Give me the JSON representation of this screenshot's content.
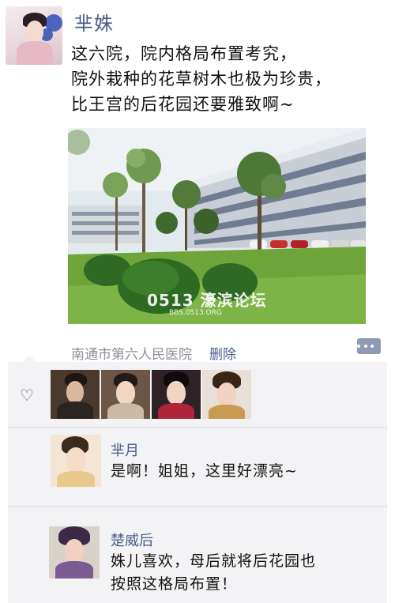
{
  "post": {
    "author": "芈姝",
    "text_lines": [
      "这六院，院内格局布置考究，",
      "院外栽种的花草树木也极为珍贵，",
      "比王宫的后花园还要雅致啊~"
    ],
    "photo_watermark": "0513 濠滨论坛",
    "photo_watermark_sub": "BBS.0513.ORG",
    "location": "南通市第六人民医院",
    "delete_label": "删除",
    "likes_count": 4
  },
  "comments": [
    {
      "author": "芈月",
      "lines": [
        "是啊！姐姐，这里好漂亮~"
      ]
    },
    {
      "author": "楚威后",
      "lines": [
        "姝儿喜欢，母后就将后花园也",
        "按照这格局布置！"
      ]
    }
  ],
  "colors": {
    "name_link": "#4a5c86",
    "comment_bg": "#f3f3f5",
    "meta_gray": "#8b8f96",
    "more_button": "#8f9bb4"
  },
  "icons": [
    "heart-icon",
    "more-icon"
  ]
}
